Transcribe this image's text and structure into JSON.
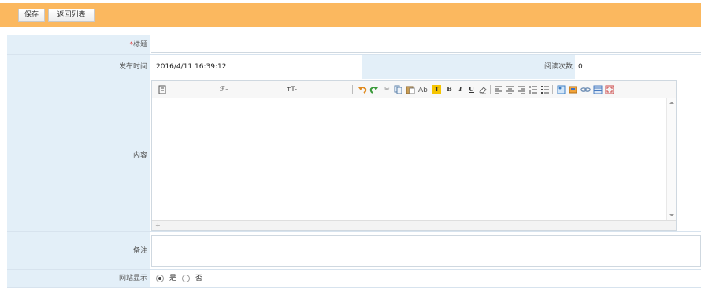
{
  "toolbar": {
    "save_label": "保存",
    "back_label": "返回列表"
  },
  "form": {
    "title": {
      "required_mark": "*",
      "label": "标题",
      "value": ""
    },
    "publish_time": {
      "label": "发布时间",
      "value": "2016/4/11 16:39:12"
    },
    "read_count": {
      "label": "阅读次数",
      "value": "0"
    },
    "content": {
      "label": "内容",
      "editor_toolbar": {
        "font_family_glyph": "ℱ",
        "font_size_glyph": "тT",
        "bold": "B",
        "italic": "I",
        "underline": "U",
        "highlight": "T",
        "text_color": "Ab"
      },
      "value": ""
    },
    "note": {
      "label": "备注",
      "value": ""
    },
    "website_display": {
      "label": "网站显示",
      "options": [
        "是",
        "否"
      ],
      "selected": "是"
    }
  },
  "colors": {
    "topbar": "#fbb85f",
    "label_bg": "#e3eff8",
    "required": "#e04343"
  }
}
